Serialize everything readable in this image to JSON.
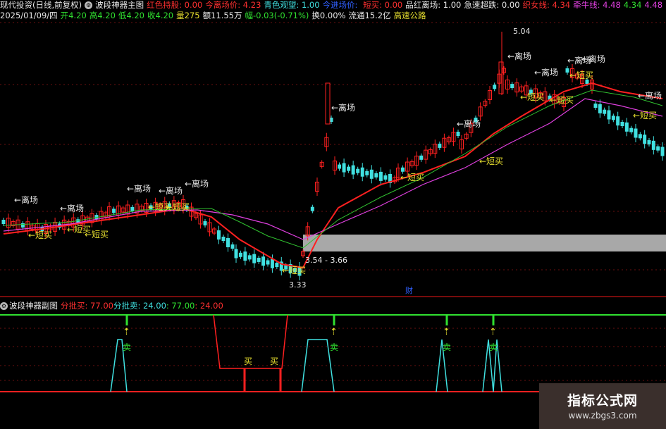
{
  "header": {
    "title": "现代投资(日线,前复权)",
    "indicator": "波段神器主图",
    "items": [
      {
        "label": "红色持股: 0.00",
        "color": "#ff3030"
      },
      {
        "label": "今离场价: 4.23",
        "color": "#ff3030"
      },
      {
        "label": "青色观望: 1.00",
        "color": "#40e0e0"
      },
      {
        "label": "今进场价: ",
        "color": "#3060ff"
      },
      {
        "label": "短买: 0.00",
        "color": "#ff3030"
      },
      {
        "label": "品红离场: 1.00",
        "color": "#e8e8e8"
      },
      {
        "label": "急速超跌: 0.00",
        "color": "#e8e8e8"
      },
      {
        "label": "织女线: 4.34",
        "color": "#ff3030"
      },
      {
        "label": "牵牛线: 4.48",
        "color": "#e040e0"
      },
      {
        "label": "4.34",
        "color": "#30e030"
      },
      {
        "label": "4.48",
        "color": "#e040e0"
      }
    ],
    "row2": [
      {
        "label": "2025/01/09/四",
        "color": "#e8e8e8"
      },
      {
        "label": "开4.20",
        "color": "#30e030"
      },
      {
        "label": "高4.20",
        "color": "#30e030"
      },
      {
        "label": "低4.20",
        "color": "#30e030"
      },
      {
        "label": "收4.20",
        "color": "#30e030"
      },
      {
        "label": "量275",
        "color": "#e8e030"
      },
      {
        "label": "额11.55万",
        "color": "#e8e8e8"
      },
      {
        "label": "幅-0.03(-0.71%)",
        "color": "#30e030"
      },
      {
        "label": "换0.00%",
        "color": "#e8e8e8"
      },
      {
        "label": "流通15.2亿",
        "color": "#e8e8e8"
      },
      {
        "label": "高速公路",
        "color": "#e8e030"
      }
    ]
  },
  "annotations": {
    "high_price": "5.04",
    "low_price": "3.33",
    "band_label": "3.54 - 3.66",
    "exit": "←离场",
    "buy": "←短买",
    "cai": "财"
  },
  "sub": {
    "title": "波段神器副图",
    "items": [
      {
        "label": "分批买: 77.00",
        "color": "#ff3030"
      },
      {
        "label": "分批卖: 24.00",
        "color": "#40e0e0"
      },
      {
        "label": ": 77.00",
        "color": "#30e030"
      },
      {
        "label": ": 24.00",
        "color": "#ff3030"
      }
    ],
    "sell": "卖",
    "buy": "买"
  },
  "watermark": {
    "line1": "指标公式网",
    "line2": "www.zbgs3.com"
  }
}
